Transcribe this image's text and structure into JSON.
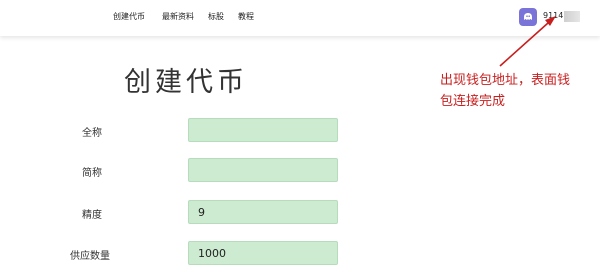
{
  "nav": {
    "items": [
      "创建代币",
      "最新资料",
      "标股",
      "教程"
    ]
  },
  "wallet": {
    "icon": "wallet-icon",
    "address_prefix": "9114"
  },
  "page": {
    "title": "创建代币"
  },
  "form": {
    "fields": [
      {
        "label": "全称",
        "value": "",
        "placeholder": ""
      },
      {
        "label": "简称",
        "value": "",
        "placeholder": ""
      },
      {
        "label": "精度",
        "value": "9",
        "placeholder": ""
      },
      {
        "label": "供应数量",
        "value": "1000",
        "placeholder": ""
      }
    ],
    "input_color": "#cdebd1"
  },
  "annotation": {
    "text": "出现钱包地址，表面钱包连接完成",
    "color": "#c81e1e"
  }
}
